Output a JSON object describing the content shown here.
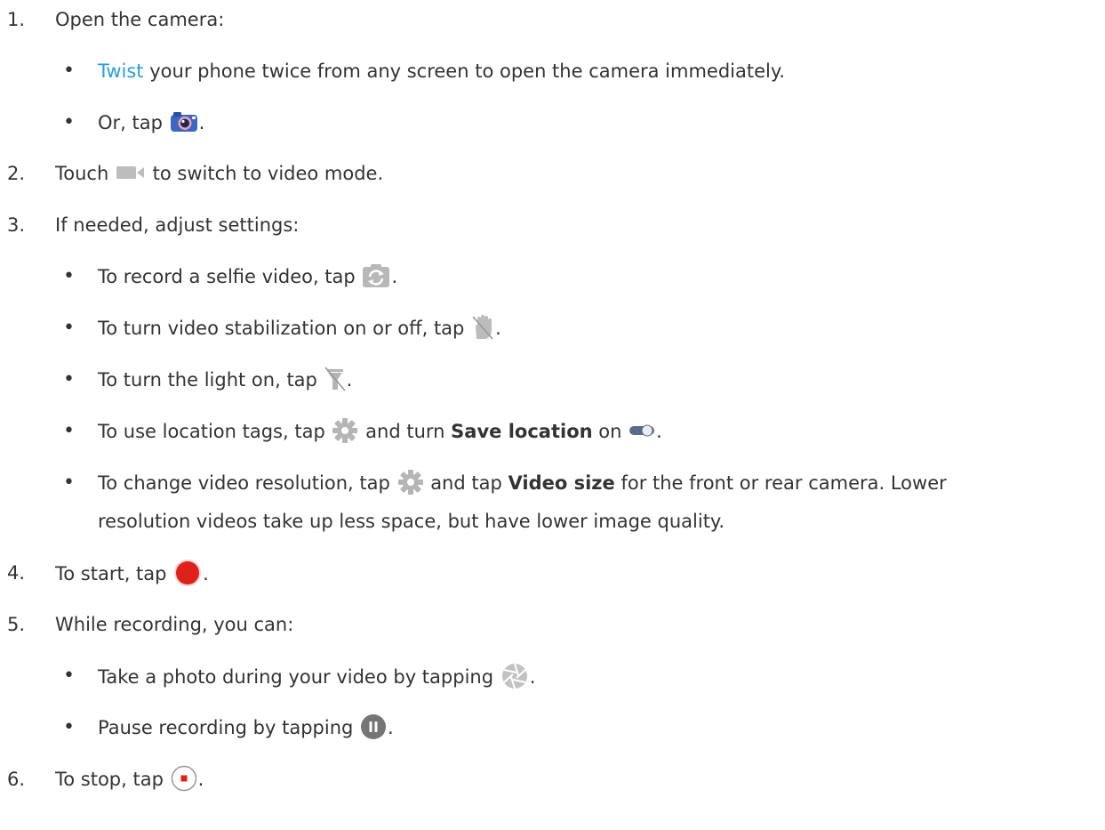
{
  "steps": [
    {
      "num": "1.",
      "text": "Open the camera:"
    },
    {
      "num": "2.",
      "pre": "Touch",
      "post": "to switch to video mode."
    },
    {
      "num": "3.",
      "text": "If needed, adjust settings:"
    },
    {
      "num": "4.",
      "pre": "To start, tap",
      "post": "."
    },
    {
      "num": "5.",
      "text": "While recording, you can:"
    },
    {
      "num": "6.",
      "pre": "To stop, tap",
      "post": "."
    }
  ],
  "step1_bullets": {
    "twist": {
      "link": "Twist",
      "rest": "your phone twice from any screen to open the camera immediately."
    },
    "tap": {
      "pre": "Or, tap",
      "post": "."
    }
  },
  "step3_bullets": {
    "selfie": {
      "pre": "To record a selfie video, tap",
      "post": "."
    },
    "stabilization": {
      "pre": "To turn video stabilization on or off, tap",
      "post": "."
    },
    "light": {
      "pre": "To turn the light on, tap",
      "post": "."
    },
    "location": {
      "pre": "To use location tags, tap",
      "mid": "and turn",
      "bold": "Save location",
      "post": "on",
      "end": "."
    },
    "resolution": {
      "pre": "To change video resolution, tap",
      "mid": "and tap",
      "bold": "Video size",
      "post": "for the front or rear camera. Lower",
      "line2": "resolution videos take up less space, but have lower image quality."
    }
  },
  "step5_bullets": {
    "photo": {
      "pre": "Take a photo during your video by tapping",
      "post": "."
    },
    "pause": {
      "pre": "Pause recording by tapping",
      "post": "."
    }
  },
  "bullet_char": "•",
  "colors": {
    "text": "#333333",
    "link": "#2a9fd8",
    "record": "#e0201b",
    "icon_gray": "#b5b5b5"
  }
}
